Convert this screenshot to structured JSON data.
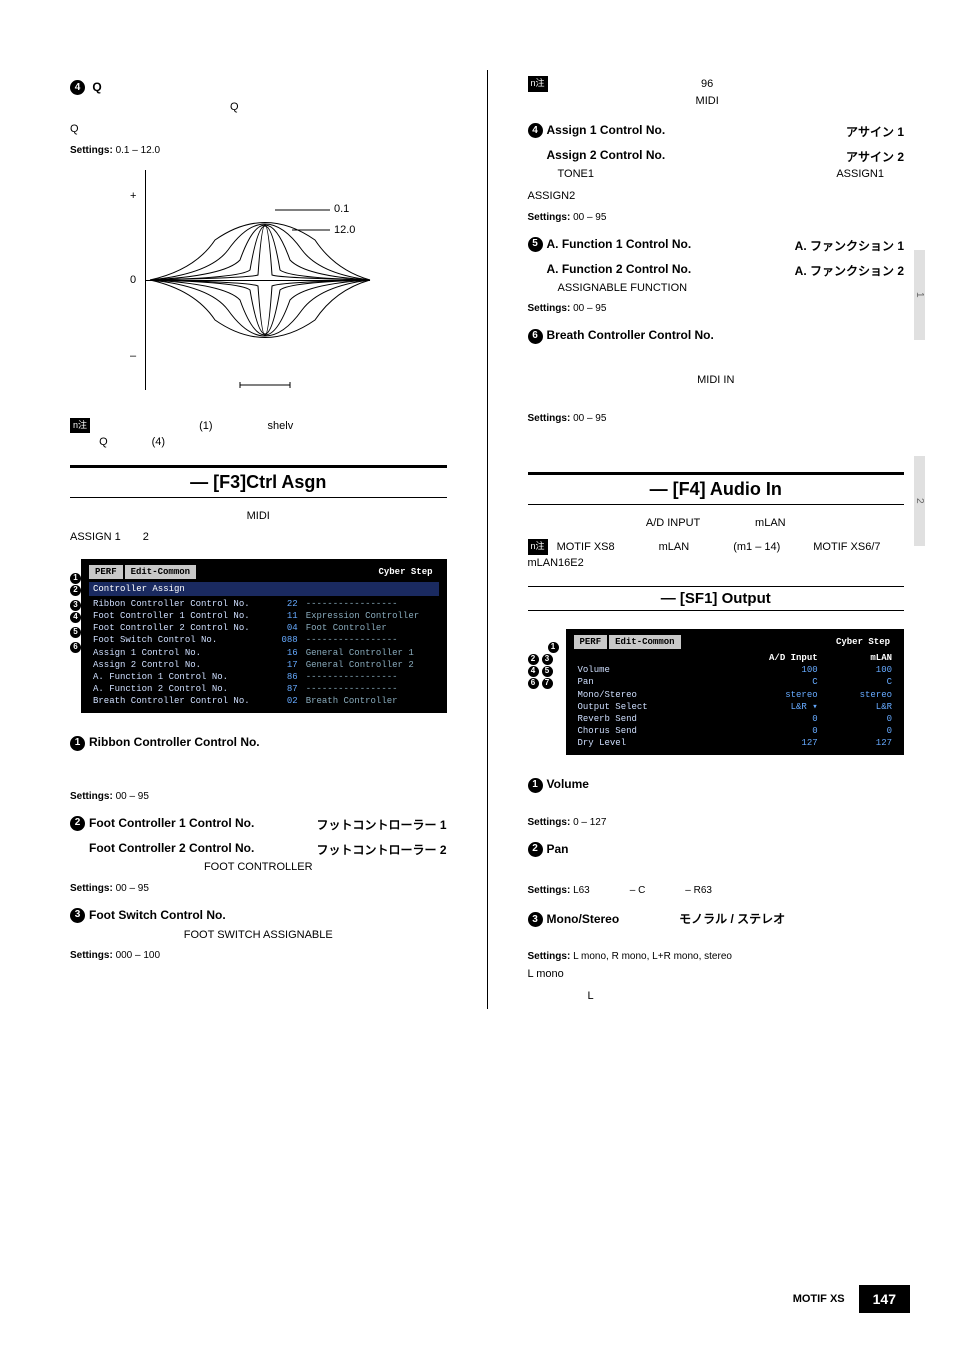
{
  "left": {
    "q": {
      "num": "4",
      "title": "Q",
      "desc_line1": "Q",
      "desc_line2": "Q",
      "settings_label": "Settings:",
      "settings_val": "0.1 – 12.0",
      "graph": {
        "plus": "+",
        "zero": "0",
        "minus": "–",
        "l01": "0.1",
        "l120": "12.0"
      },
      "note_icon": "n注",
      "note_line1": "(1)　　　　　shelv",
      "note_line2": "Q　　　　(4)"
    },
    "f3": {
      "title": "— [F3]Ctrl Asgn",
      "intro1": "MIDI",
      "intro2": "ASSIGN 1　　2",
      "shot": {
        "tabs": [
          "PERF",
          "Edit-Common"
        ],
        "top_right": "Cyber Step",
        "head": "Controller Assign",
        "rows": [
          {
            "n": "1",
            "name": "Ribbon Controller Control No.",
            "v": "22",
            "d": "-----------------"
          },
          {
            "n": "2",
            "name": "Foot Controller 1 Control No.",
            "v": "11",
            "d": "Expression Controller"
          },
          {
            "n": "",
            "name": "Foot Controller 2 Control No.",
            "v": "04",
            "d": "Foot Controller"
          },
          {
            "n": "3",
            "name": "Foot Switch Control No.",
            "v": "088",
            "d": "-----------------"
          },
          {
            "n": "4",
            "name": "Assign 1 Control No.",
            "v": "16",
            "d": "General Controller 1"
          },
          {
            "n": "",
            "name": "Assign 2 Control No.",
            "v": "17",
            "d": "General Controller 2"
          },
          {
            "n": "5",
            "name": "A. Function 1 Control No.",
            "v": "86",
            "d": "-----------------"
          },
          {
            "n": "",
            "name": "A. Function 2 Control No.",
            "v": "87",
            "d": "-----------------"
          },
          {
            "n": "6",
            "name": "Breath Controller Control No.",
            "v": "02",
            "d": "Breath Controller"
          }
        ]
      },
      "p1": {
        "num": "1",
        "title": "Ribbon Controller Control No.",
        "set_lbl": "Settings:",
        "set_val": "00 – 95"
      },
      "p2": {
        "num": "2",
        "title": "Foot Controller 1 Control No.",
        "titleR": "フットコントローラー 1",
        "row2": "Foot Controller 2 Control No.",
        "row2R": "フットコントローラー 2",
        "body": "FOOT CONTROLLER",
        "set_lbl": "Settings:",
        "set_val": "00 – 95"
      },
      "p3": {
        "num": "3",
        "title": "Foot Switch Control No.",
        "body": "FOOT SWITCH ASSIGNABLE",
        "set_lbl": "Settings:",
        "set_val": "000 – 100"
      }
    }
  },
  "right": {
    "topnote": {
      "icon": "n注",
      "line1": "96",
      "line2": "MIDI"
    },
    "p4": {
      "num": "4",
      "t1": "Assign 1 Control No.",
      "t1R": "アサイン 1",
      "t2": "Assign 2 Control No.",
      "t2R": "アサイン 2",
      "b1": "TONE1",
      "b1R": "ASSIGN1",
      "b2": "ASSIGN2",
      "set_lbl": "Settings:",
      "set_val": "00 – 95"
    },
    "p5": {
      "num": "5",
      "t1": "A. Function 1 Control No.",
      "t1R": "A. ファンクション 1",
      "t2": "A. Function 2 Control No.",
      "t2R": "A. ファンクション 2",
      "b": "ASSIGNABLE FUNCTION",
      "set_lbl": "Settings:",
      "set_val": "00 – 95"
    },
    "p6": {
      "num": "6",
      "t": "Breath Controller Control No.",
      "b": "MIDI IN",
      "set_lbl": "Settings:",
      "set_val": "00 – 95"
    },
    "f4": {
      "title": "— [F4] Audio In",
      "sub": "A/D INPUT　　　　　mLAN",
      "note_icon": "n注",
      "note": "MOTIF XS8　　　　mLAN　　　　(m1 – 14)　　　MOTIF XS6/7　　　　mLAN16E2"
    },
    "sf1": {
      "title": "— [SF1] Output",
      "shot": {
        "tabs": [
          "PERF",
          "Edit-Common"
        ],
        "top_right": "Cyber Step",
        "hdr": [
          "",
          "A/D Input",
          "mLAN"
        ],
        "rows": [
          {
            "n": "1",
            "name": "Volume",
            "a": "100",
            "b": "100"
          },
          {
            "n": "2",
            "name": "Pan",
            "a": "C",
            "b": "C"
          },
          {
            "n": "3",
            "name": "Mono/Stereo",
            "a": "stereo",
            "b": "stereo"
          },
          {
            "n": "4",
            "name": "Output Select",
            "a": "L&R ▾",
            "b": "L&R"
          },
          {
            "n": "5",
            "name": "Reverb Send",
            "a": "0",
            "b": "0"
          },
          {
            "n": "6",
            "name": "Chorus Send",
            "a": "0",
            "b": "0"
          },
          {
            "n": "7",
            "name": "Dry Level",
            "a": "127",
            "b": "127"
          }
        ]
      },
      "p1": {
        "num": "1",
        "t": "Volume",
        "set_lbl": "Settings:",
        "set_val": "0 – 127"
      },
      "p2": {
        "num": "2",
        "t": "Pan",
        "set_lbl": "Settings:",
        "set_val": "L63　　　　– C　　　　– R63"
      },
      "p3": {
        "num": "3",
        "t": "Mono/Stereo",
        "tR": "モノラル / ステレオ",
        "set_lbl": "Settings:",
        "set_val": "L mono, R mono, L+R mono, stereo",
        "b1": "L mono",
        "b2": "L"
      }
    }
  },
  "footer": {
    "model": "MOTIF XS",
    "page": "147"
  },
  "tabs": {
    "t1": "1",
    "t2": "2"
  }
}
